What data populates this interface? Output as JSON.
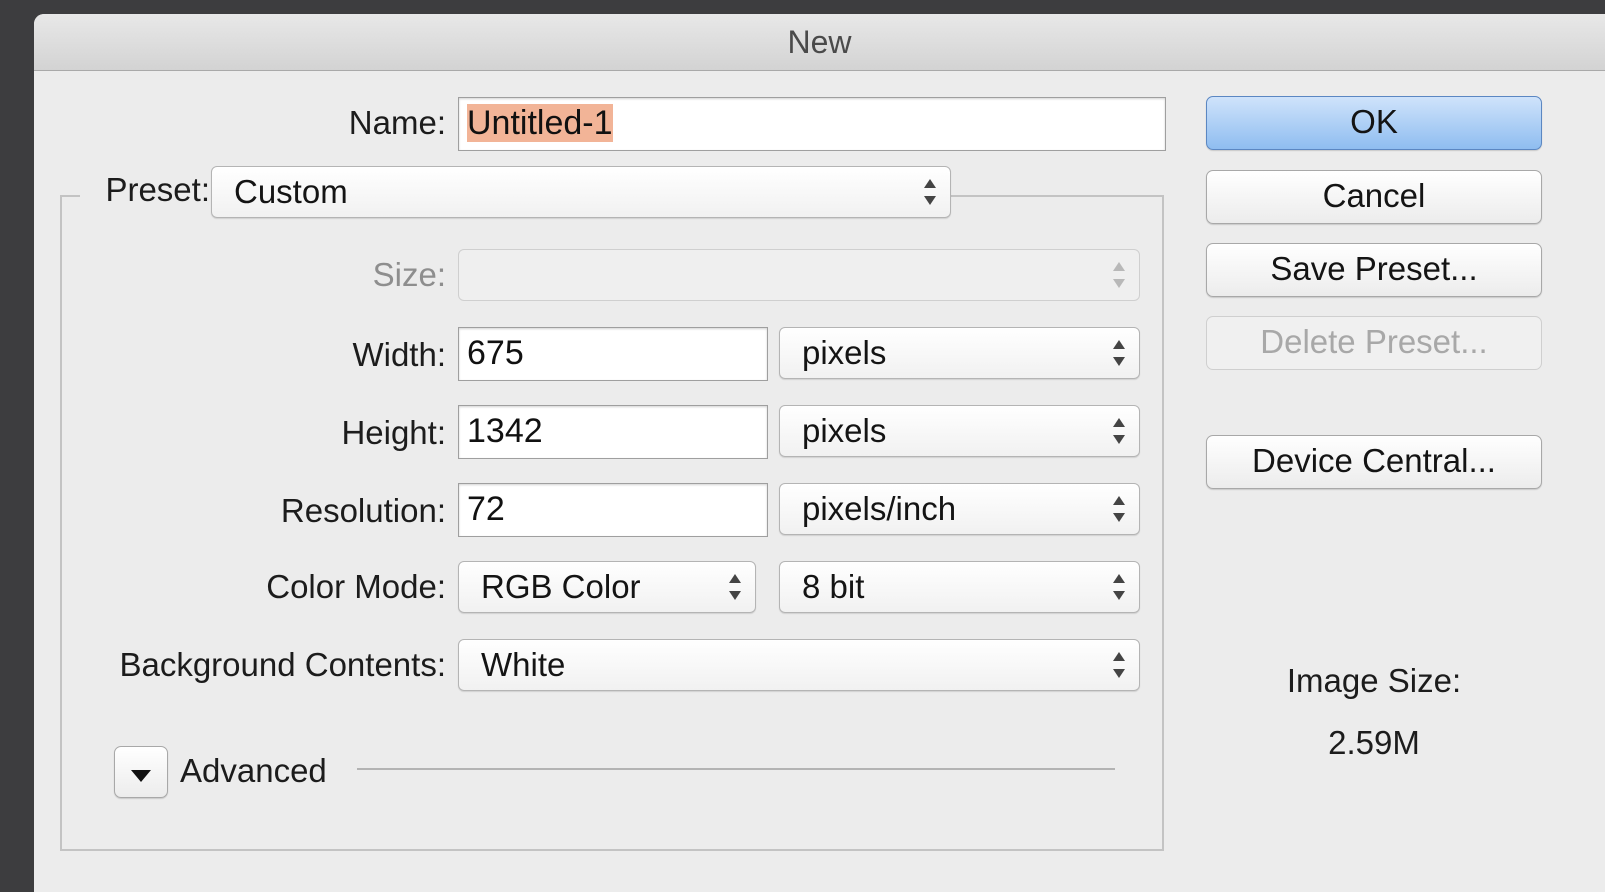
{
  "window": {
    "title": "New"
  },
  "name": {
    "label": "Name:",
    "value": "Untitled-1"
  },
  "preset": {
    "label": "Preset:",
    "value": "Custom"
  },
  "size": {
    "label": "Size:",
    "value": ""
  },
  "width": {
    "label": "Width:",
    "value": "675",
    "unit": "pixels"
  },
  "height": {
    "label": "Height:",
    "value": "1342",
    "unit": "pixels"
  },
  "resolution": {
    "label": "Resolution:",
    "value": "72",
    "unit": "pixels/inch"
  },
  "color_mode": {
    "label": "Color Mode:",
    "mode": "RGB Color",
    "depth": "8 bit"
  },
  "background": {
    "label": "Background Contents:",
    "value": "White"
  },
  "advanced": {
    "label": "Advanced"
  },
  "buttons": {
    "ok": "OK",
    "cancel": "Cancel",
    "save_preset": "Save Preset...",
    "delete_preset": "Delete Preset...",
    "device_central": "Device Central..."
  },
  "image_size": {
    "label": "Image Size:",
    "value": "2.59M"
  }
}
